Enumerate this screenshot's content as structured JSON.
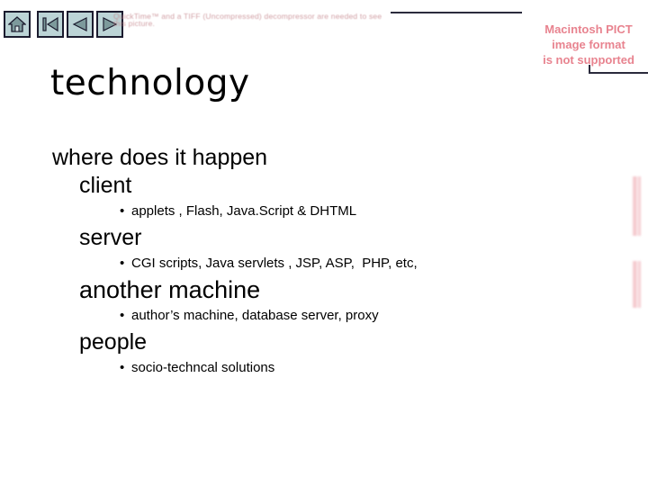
{
  "nav": {
    "buttons": [
      {
        "name": "home-button",
        "icon": "home-icon",
        "label": "Home"
      },
      {
        "name": "first-button",
        "icon": "first-page-icon",
        "label": "First"
      },
      {
        "name": "back-button",
        "icon": "previous-icon",
        "label": "Back"
      },
      {
        "name": "forward-button",
        "icon": "next-icon",
        "label": "Forward"
      }
    ]
  },
  "placeholders": {
    "quicktime_text": "QuickTime™ and a TIFF (Uncompressed) decompressor are needed to see this picture.",
    "pict_line1": "Macintosh PICT",
    "pict_line2": "image format",
    "pict_line3": "is not supported"
  },
  "slide": {
    "title": "technology",
    "blocks": [
      {
        "heading": "where does it happen",
        "level": 1,
        "sub": []
      },
      {
        "heading": "client",
        "level": 2,
        "sub": [
          "applets , Flash, Java.Script & DHTML"
        ]
      },
      {
        "heading": "server",
        "level": 2,
        "sub": [
          "CGI scripts, Java servlets , JSP, ASP,  PHP, etc,"
        ]
      },
      {
        "heading": "another machine",
        "level": 2,
        "sub": [
          "author’s machine, database server, proxy"
        ]
      },
      {
        "heading": "people",
        "level": 2,
        "sub": [
          "socio-techncal solutions"
        ]
      }
    ]
  },
  "colors": {
    "background": "#ffffff",
    "text": "#000000",
    "button_face": "#bcd4d6",
    "button_border": "#1b1b2e",
    "button_glyph": "#6f8e90",
    "error_red": "#e8838f",
    "rule": "#2a2a3c"
  }
}
